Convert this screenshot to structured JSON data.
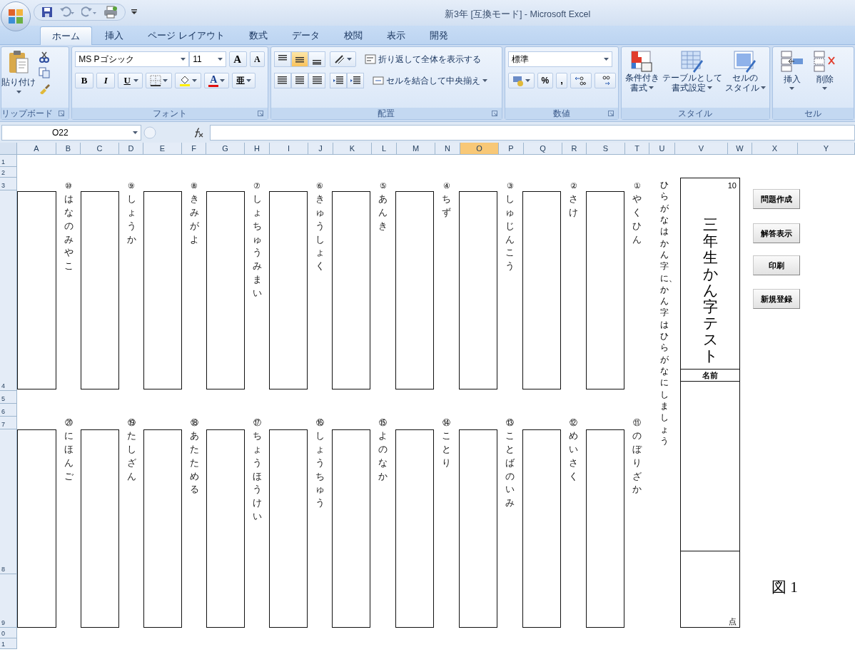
{
  "window": {
    "title": "新3年 [互換モード] - Microsoft Excel"
  },
  "ribbon_tabs": [
    {
      "label": "ホーム",
      "selected": true
    },
    {
      "label": "挿入",
      "selected": false
    },
    {
      "label": "ページ レイアウト",
      "selected": false
    },
    {
      "label": "数式",
      "selected": false
    },
    {
      "label": "データ",
      "selected": false
    },
    {
      "label": "校閲",
      "selected": false
    },
    {
      "label": "表示",
      "selected": false
    },
    {
      "label": "開発",
      "selected": false
    }
  ],
  "clipboard": {
    "paste": "貼り付け",
    "label": "リップボード"
  },
  "font": {
    "name": "MS Pゴシック",
    "size": "11",
    "grow": "A",
    "shrink": "A",
    "bold": "B",
    "italic": "I",
    "underline": "U",
    "color_letter": "A",
    "phonetic": "亜",
    "label": "フォント"
  },
  "alignment": {
    "vertical": [
      {
        "selected": false
      },
      {
        "selected": true
      },
      {
        "selected": false
      }
    ],
    "wrap": "折り返して全体を表示する",
    "merge": "セルを結合して中央揃え",
    "label": "配置"
  },
  "number": {
    "format": "標準",
    "percent": "%",
    "comma": ",",
    "label": "数値"
  },
  "styles": {
    "items": [
      {
        "lines": [
          "条件付き",
          "書式"
        ]
      },
      {
        "lines": [
          "テーブルとして",
          "書式設定"
        ]
      },
      {
        "lines": [
          "セルの",
          "スタイル"
        ]
      }
    ],
    "label": "スタイル"
  },
  "cells": {
    "items": [
      "挿入",
      "削除"
    ],
    "label": "セル"
  },
  "formula_bar": {
    "name_box": "O22"
  },
  "columns": [
    {
      "label": "A",
      "selected": false
    },
    {
      "label": "B",
      "selected": false
    },
    {
      "label": "C",
      "selected": false
    },
    {
      "label": "D",
      "selected": false
    },
    {
      "label": "E",
      "selected": false
    },
    {
      "label": "F",
      "selected": false
    },
    {
      "label": "G",
      "selected": false
    },
    {
      "label": "H",
      "selected": false
    },
    {
      "label": "I",
      "selected": false
    },
    {
      "label": "J",
      "selected": false
    },
    {
      "label": "K",
      "selected": false
    },
    {
      "label": "L",
      "selected": false
    },
    {
      "label": "M",
      "selected": false
    },
    {
      "label": "N",
      "selected": false
    },
    {
      "label": "O",
      "selected": true
    },
    {
      "label": "P",
      "selected": false
    },
    {
      "label": "Q",
      "selected": false
    },
    {
      "label": "R",
      "selected": false
    },
    {
      "label": "S",
      "selected": false
    },
    {
      "label": "T",
      "selected": false
    },
    {
      "label": "U",
      "selected": false
    },
    {
      "label": "V",
      "selected": false
    },
    {
      "label": "W",
      "selected": false
    },
    {
      "label": "X",
      "selected": false
    },
    {
      "label": "Y",
      "selected": false
    }
  ],
  "rows": [
    "1",
    "2",
    "3",
    "4",
    "5",
    "6",
    "7",
    "8",
    "9",
    "0",
    "1"
  ],
  "questions_top": [
    {
      "number": "⑩",
      "reading": "はなのみやこ"
    },
    {
      "number": "⑨",
      "reading": "しょうか"
    },
    {
      "number": "⑧",
      "reading": "きみがよ"
    },
    {
      "number": "⑦",
      "reading": "しょちゅうみまい"
    },
    {
      "number": "⑥",
      "reading": "きゅうしょく"
    },
    {
      "number": "⑤",
      "reading": "あんき"
    },
    {
      "number": "④",
      "reading": "ちず"
    },
    {
      "number": "③",
      "reading": "しゅじんこう"
    },
    {
      "number": "②",
      "reading": "さけ"
    },
    {
      "number": "①",
      "reading": "やくひん"
    }
  ],
  "questions_bottom": [
    {
      "number": "⑳",
      "reading": "にほんご"
    },
    {
      "number": "⑲",
      "reading": "たしざん"
    },
    {
      "number": "⑱",
      "reading": "あたためる"
    },
    {
      "number": "⑰",
      "reading": "ちょうほうけい"
    },
    {
      "number": "⑯",
      "reading": "しょうちゅう"
    },
    {
      "number": "⑮",
      "reading": "よのなか"
    },
    {
      "number": "⑭",
      "reading": "ことり"
    },
    {
      "number": "⑬",
      "reading": "ことばのいみ"
    },
    {
      "number": "⑫",
      "reading": "めいさく"
    },
    {
      "number": "⑪",
      "reading": "のぼりざか"
    }
  ],
  "instruction": "ひらがなはかん字に、かん字はひらがなにしましょう",
  "title_box": {
    "count": "10",
    "title": "三年生かん字テスト",
    "name_label": "名前",
    "score_unit": "点"
  },
  "buttons": [
    "問題作成",
    "解答表示",
    "印刷",
    "新規登録"
  ],
  "figure_caption": "図 1"
}
